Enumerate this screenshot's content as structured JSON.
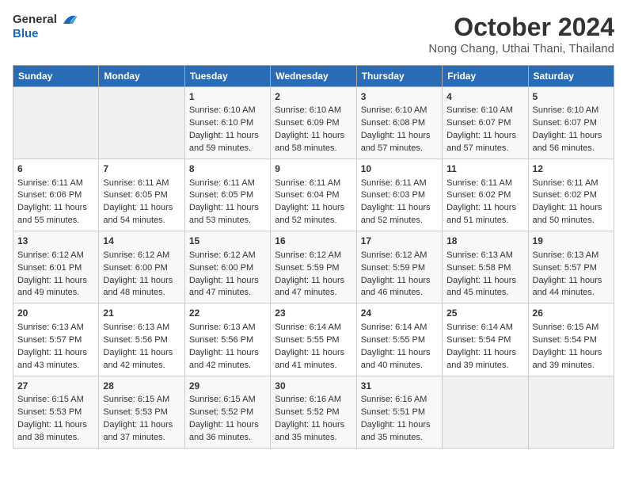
{
  "header": {
    "logo_line1": "General",
    "logo_line2": "Blue",
    "title": "October 2024",
    "subtitle": "Nong Chang, Uthai Thani, Thailand"
  },
  "days_of_week": [
    "Sunday",
    "Monday",
    "Tuesday",
    "Wednesday",
    "Thursday",
    "Friday",
    "Saturday"
  ],
  "weeks": [
    [
      {
        "day": "",
        "info": ""
      },
      {
        "day": "",
        "info": ""
      },
      {
        "day": "1",
        "info": "Sunrise: 6:10 AM\nSunset: 6:10 PM\nDaylight: 11 hours and 59 minutes."
      },
      {
        "day": "2",
        "info": "Sunrise: 6:10 AM\nSunset: 6:09 PM\nDaylight: 11 hours and 58 minutes."
      },
      {
        "day": "3",
        "info": "Sunrise: 6:10 AM\nSunset: 6:08 PM\nDaylight: 11 hours and 57 minutes."
      },
      {
        "day": "4",
        "info": "Sunrise: 6:10 AM\nSunset: 6:07 PM\nDaylight: 11 hours and 57 minutes."
      },
      {
        "day": "5",
        "info": "Sunrise: 6:10 AM\nSunset: 6:07 PM\nDaylight: 11 hours and 56 minutes."
      }
    ],
    [
      {
        "day": "6",
        "info": "Sunrise: 6:11 AM\nSunset: 6:06 PM\nDaylight: 11 hours and 55 minutes."
      },
      {
        "day": "7",
        "info": "Sunrise: 6:11 AM\nSunset: 6:05 PM\nDaylight: 11 hours and 54 minutes."
      },
      {
        "day": "8",
        "info": "Sunrise: 6:11 AM\nSunset: 6:05 PM\nDaylight: 11 hours and 53 minutes."
      },
      {
        "day": "9",
        "info": "Sunrise: 6:11 AM\nSunset: 6:04 PM\nDaylight: 11 hours and 52 minutes."
      },
      {
        "day": "10",
        "info": "Sunrise: 6:11 AM\nSunset: 6:03 PM\nDaylight: 11 hours and 52 minutes."
      },
      {
        "day": "11",
        "info": "Sunrise: 6:11 AM\nSunset: 6:02 PM\nDaylight: 11 hours and 51 minutes."
      },
      {
        "day": "12",
        "info": "Sunrise: 6:11 AM\nSunset: 6:02 PM\nDaylight: 11 hours and 50 minutes."
      }
    ],
    [
      {
        "day": "13",
        "info": "Sunrise: 6:12 AM\nSunset: 6:01 PM\nDaylight: 11 hours and 49 minutes."
      },
      {
        "day": "14",
        "info": "Sunrise: 6:12 AM\nSunset: 6:00 PM\nDaylight: 11 hours and 48 minutes."
      },
      {
        "day": "15",
        "info": "Sunrise: 6:12 AM\nSunset: 6:00 PM\nDaylight: 11 hours and 47 minutes."
      },
      {
        "day": "16",
        "info": "Sunrise: 6:12 AM\nSunset: 5:59 PM\nDaylight: 11 hours and 47 minutes."
      },
      {
        "day": "17",
        "info": "Sunrise: 6:12 AM\nSunset: 5:59 PM\nDaylight: 11 hours and 46 minutes."
      },
      {
        "day": "18",
        "info": "Sunrise: 6:13 AM\nSunset: 5:58 PM\nDaylight: 11 hours and 45 minutes."
      },
      {
        "day": "19",
        "info": "Sunrise: 6:13 AM\nSunset: 5:57 PM\nDaylight: 11 hours and 44 minutes."
      }
    ],
    [
      {
        "day": "20",
        "info": "Sunrise: 6:13 AM\nSunset: 5:57 PM\nDaylight: 11 hours and 43 minutes."
      },
      {
        "day": "21",
        "info": "Sunrise: 6:13 AM\nSunset: 5:56 PM\nDaylight: 11 hours and 42 minutes."
      },
      {
        "day": "22",
        "info": "Sunrise: 6:13 AM\nSunset: 5:56 PM\nDaylight: 11 hours and 42 minutes."
      },
      {
        "day": "23",
        "info": "Sunrise: 6:14 AM\nSunset: 5:55 PM\nDaylight: 11 hours and 41 minutes."
      },
      {
        "day": "24",
        "info": "Sunrise: 6:14 AM\nSunset: 5:55 PM\nDaylight: 11 hours and 40 minutes."
      },
      {
        "day": "25",
        "info": "Sunrise: 6:14 AM\nSunset: 5:54 PM\nDaylight: 11 hours and 39 minutes."
      },
      {
        "day": "26",
        "info": "Sunrise: 6:15 AM\nSunset: 5:54 PM\nDaylight: 11 hours and 39 minutes."
      }
    ],
    [
      {
        "day": "27",
        "info": "Sunrise: 6:15 AM\nSunset: 5:53 PM\nDaylight: 11 hours and 38 minutes."
      },
      {
        "day": "28",
        "info": "Sunrise: 6:15 AM\nSunset: 5:53 PM\nDaylight: 11 hours and 37 minutes."
      },
      {
        "day": "29",
        "info": "Sunrise: 6:15 AM\nSunset: 5:52 PM\nDaylight: 11 hours and 36 minutes."
      },
      {
        "day": "30",
        "info": "Sunrise: 6:16 AM\nSunset: 5:52 PM\nDaylight: 11 hours and 35 minutes."
      },
      {
        "day": "31",
        "info": "Sunrise: 6:16 AM\nSunset: 5:51 PM\nDaylight: 11 hours and 35 minutes."
      },
      {
        "day": "",
        "info": ""
      },
      {
        "day": "",
        "info": ""
      }
    ]
  ]
}
